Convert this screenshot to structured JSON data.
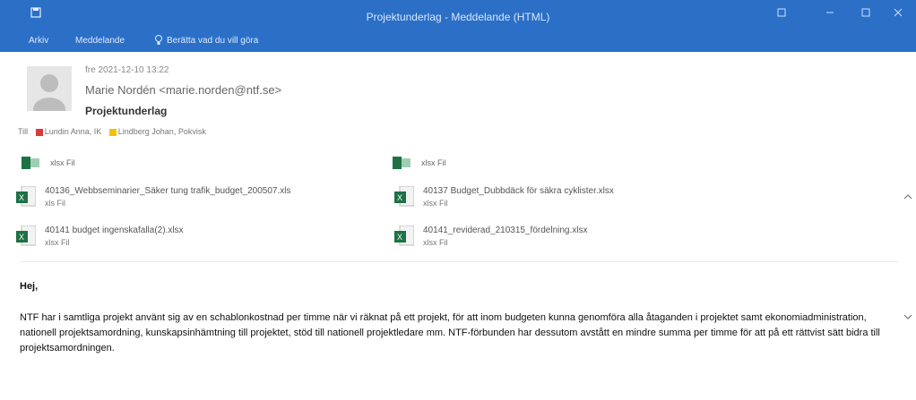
{
  "window": {
    "title": "Projektunderlag - Meddelande (HTML)"
  },
  "ribbon": {
    "tabs": [
      {
        "label": "Arkiv"
      },
      {
        "label": "Meddelande"
      }
    ],
    "tell_me": "Berätta vad du vill göra"
  },
  "header": {
    "date": "fre 2021-12-10 13:22",
    "sender": "Marie Nordén <marie.norden@ntf.se>",
    "subject": "Projektunderlag",
    "to_label": "Till",
    "recipients": [
      {
        "name": "Lundin Anna, IK",
        "color": "#d83b3b"
      },
      {
        "name": "Lindberg Johan, Pokvisk",
        "color": "#f2c200"
      }
    ]
  },
  "attachments_top": [
    {
      "type": "xlsx Fil"
    },
    {
      "type": "xlsx Fil"
    }
  ],
  "attachments": [
    {
      "name": "40136_Webbseminarier_Säker tung trafik_budget_200507.xls",
      "type": "xls Fil"
    },
    {
      "name": "40137 Budget_Dubbdäck för säkra cyklister.xlsx",
      "type": "xlsx Fil"
    },
    {
      "name": "40141 budget ingenskafalla(2).xlsx",
      "type": "xlsx Fil"
    },
    {
      "name": "40141_reviderad_210315_fördelning.xlsx",
      "type": "xlsx Fil"
    }
  ],
  "body": {
    "greeting": "Hej,",
    "paragraph": "NTF har i samtliga projekt använt sig av en schablonkostnad per timme när vi räknat på ett projekt, för att inom budgeten kunna genomföra alla åtaganden i projektet samt ekonomiadministration, nationell projektsamordning, kunskapsinhämtning till projektet, stöd till nationell projektledare mm. NTF-förbunden har dessutom avstått en mindre summa per timme för att på ett rättvist sätt bidra till projektsamordningen."
  },
  "colors": {
    "titlebar": "#2b6fc7",
    "excel_green": "#1e7145"
  }
}
